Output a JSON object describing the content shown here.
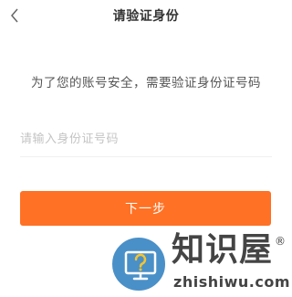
{
  "header": {
    "title": "请验证身份",
    "back_icon": "chevron-left-icon"
  },
  "main": {
    "instruction": "为了您的账号安全，需要验证身份证号码",
    "id_input": {
      "placeholder": "请输入身份证号码",
      "value": ""
    },
    "next_button_label": "下一步"
  },
  "watermark": {
    "name": "知识屋",
    "registered_mark": "®",
    "domain": "zhishiwu.com",
    "logo_icon": "monitor-question-icon"
  },
  "colors": {
    "accent": "#ff7124",
    "title_text": "#333333",
    "body_text": "#555555",
    "placeholder_text": "#c4c4c4",
    "divider": "#f0f0f0",
    "watermark_logo": "#4a90c8"
  }
}
